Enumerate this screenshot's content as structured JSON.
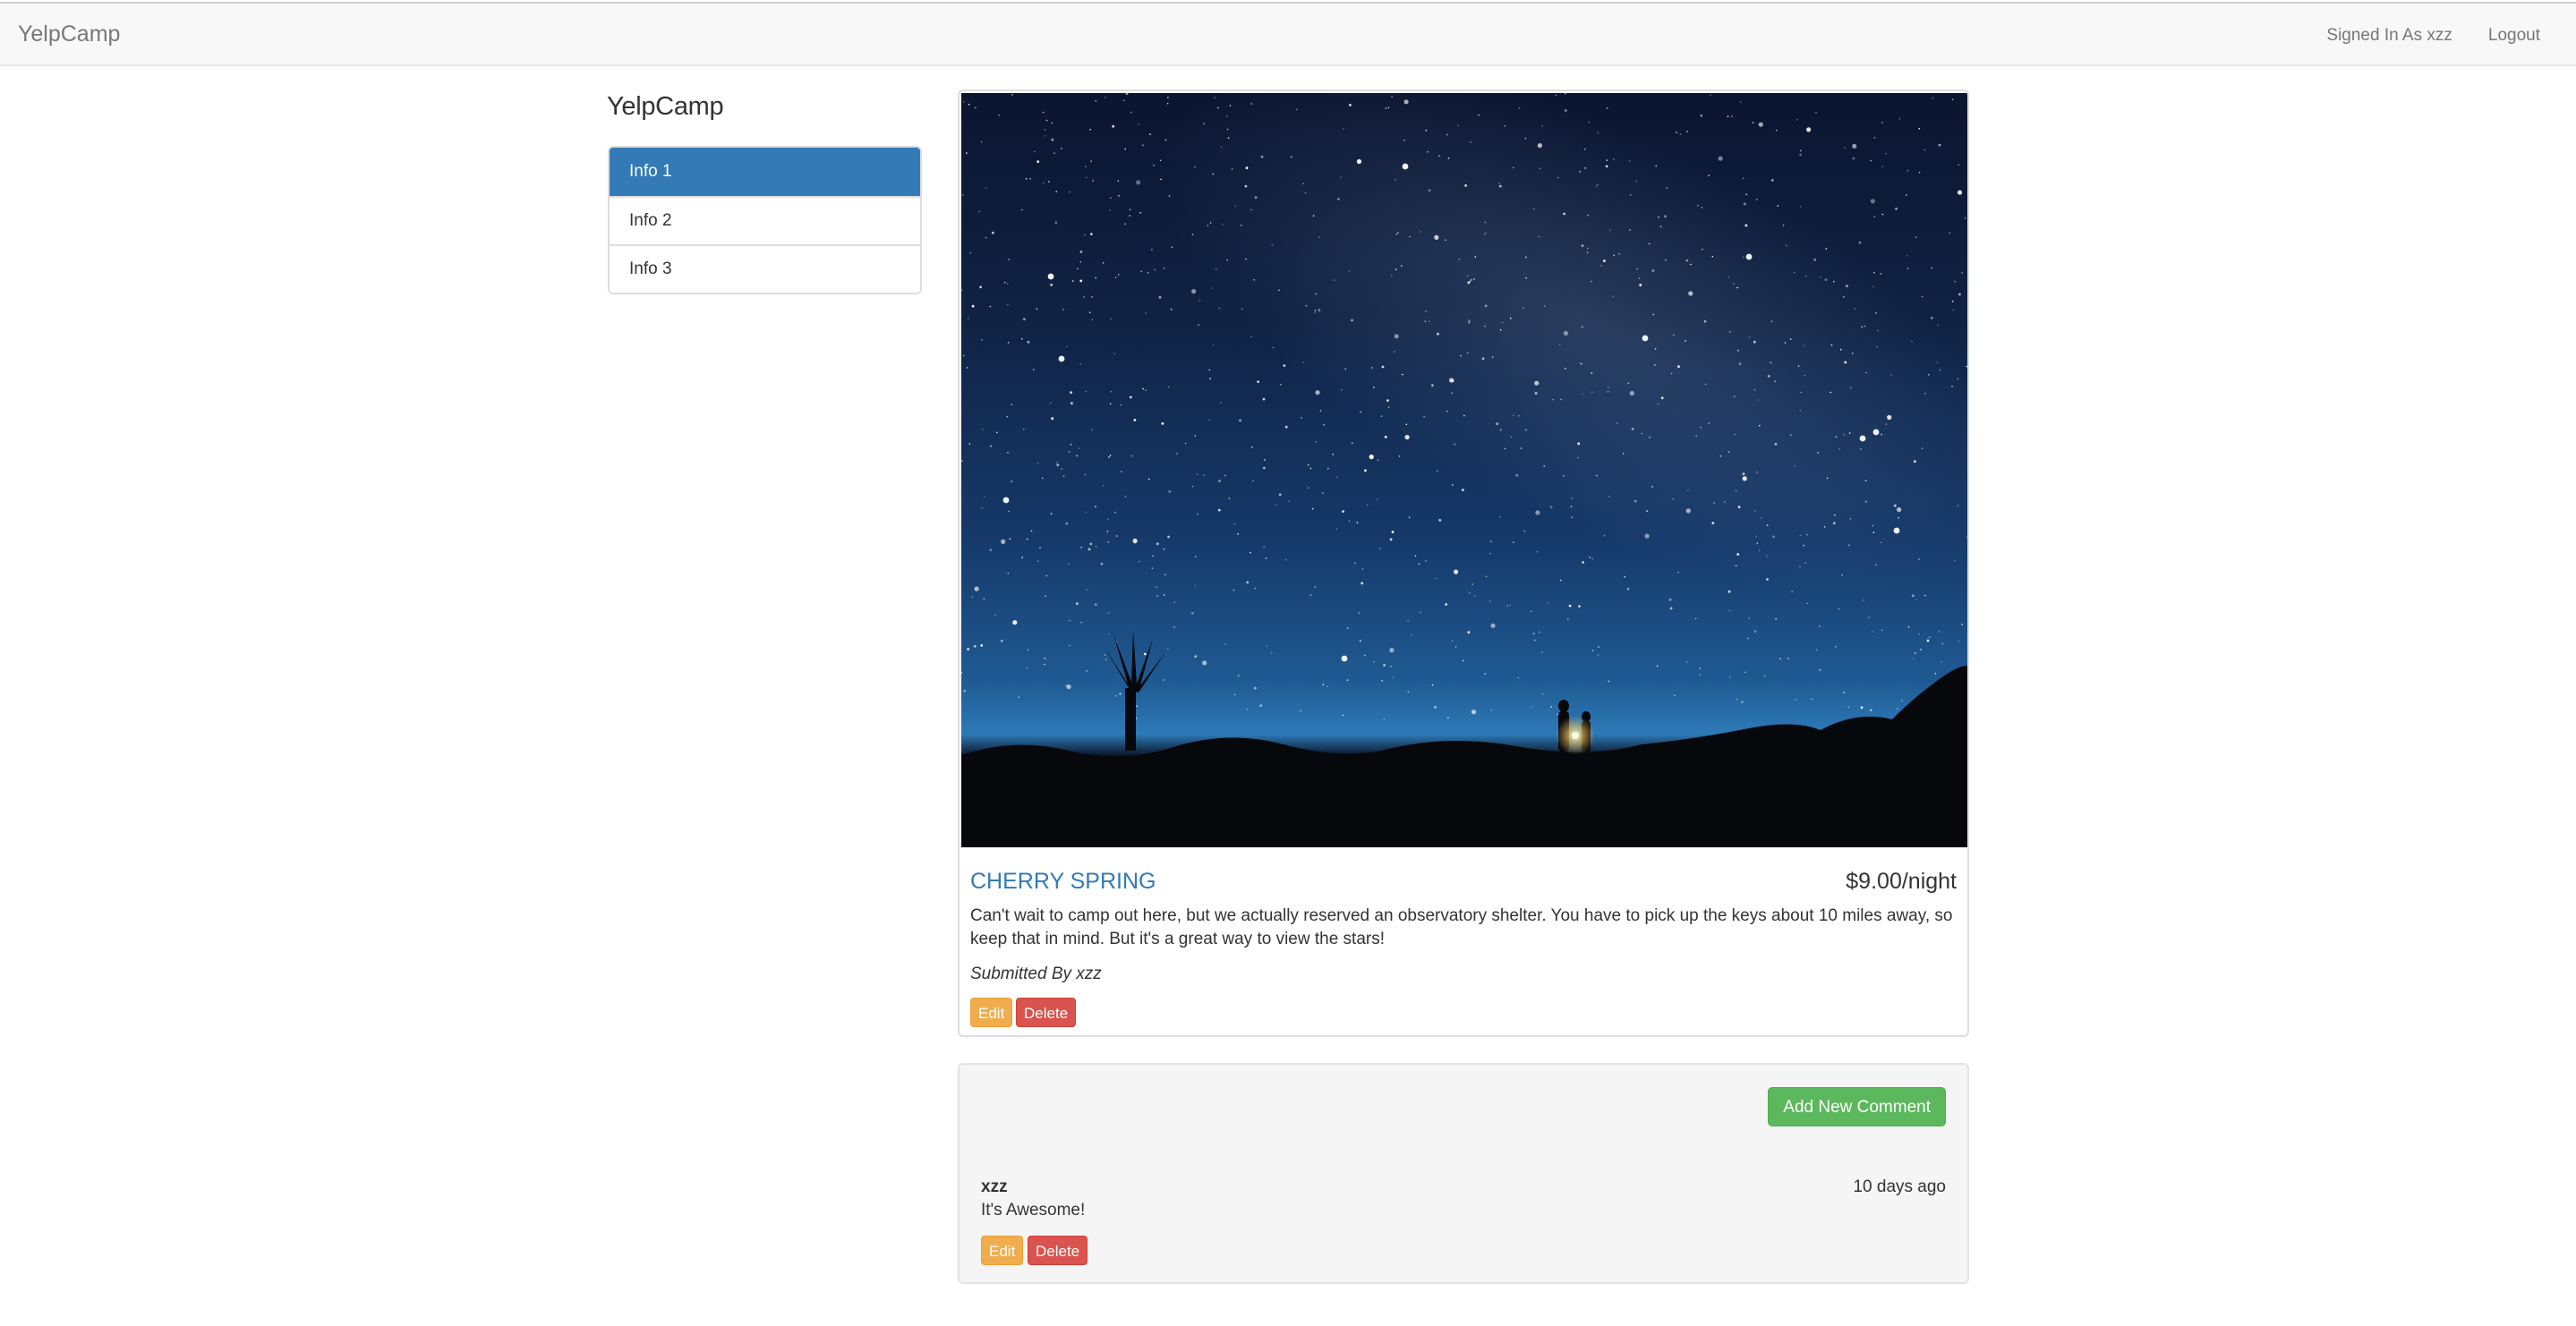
{
  "navbar": {
    "brand": "YelpCamp",
    "signed_in": "Signed In As xzz",
    "logout": "Logout"
  },
  "sidebar": {
    "title": "YelpCamp",
    "items": [
      {
        "label": "Info 1",
        "active": true
      },
      {
        "label": "Info 2",
        "active": false
      },
      {
        "label": "Info 3",
        "active": false
      }
    ]
  },
  "campground": {
    "name": "CHERRY SPRING",
    "price": "$9.00/night",
    "description": "Can't wait to camp out here, but we actually reserved an observatory shelter. You have to pick up the keys about 10 miles away, so keep that in mind. But it's a great way to view the stars!",
    "submitted_by": "Submitted By xzz",
    "edit_label": "Edit",
    "delete_label": "Delete",
    "image_description": "night-sky-with-stars-and-silhouetted-campers"
  },
  "comments": {
    "add_label": "Add New Comment",
    "items": [
      {
        "author": "xzz",
        "time": "10 days ago",
        "text": "It's Awesome!",
        "edit_label": "Edit",
        "delete_label": "Delete"
      }
    ]
  },
  "colors": {
    "primary": "#337ab7",
    "warning": "#f0ad4e",
    "danger": "#d9534f",
    "success": "#5cb85c",
    "navbar_bg": "#f8f8f8",
    "well_bg": "#f5f5f5"
  }
}
